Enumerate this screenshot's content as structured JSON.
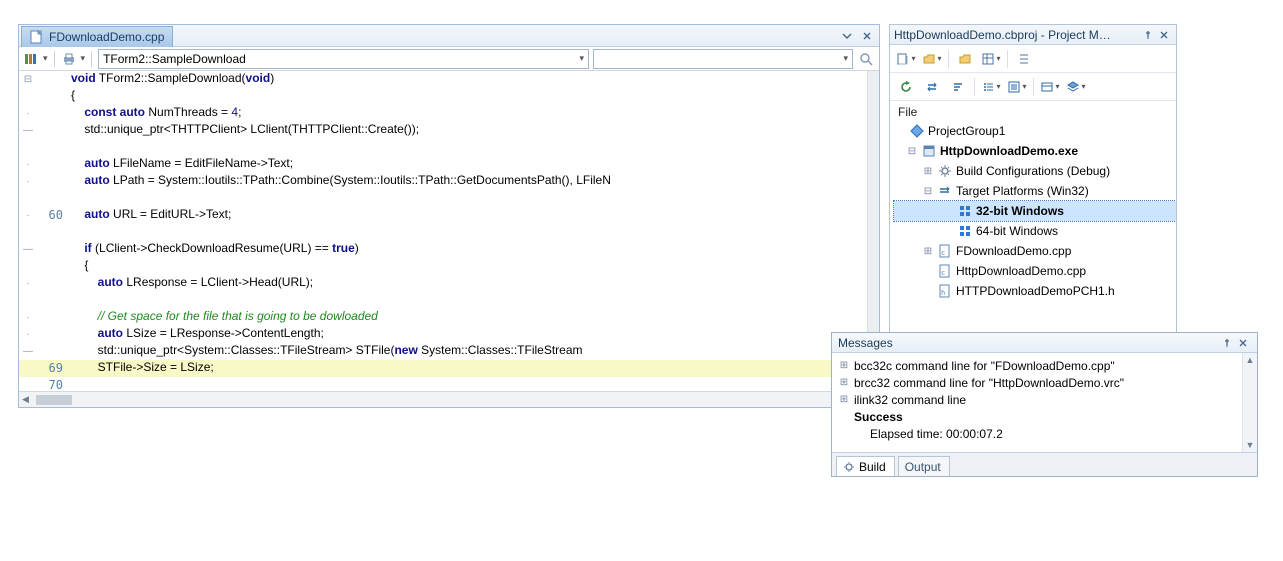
{
  "editor": {
    "tabLabel": "FDownloadDemo.cpp",
    "navSelection": "TForm2::SampleDownload",
    "lines": [
      {
        "fold": "⊟",
        "num": "",
        "html": "<span class='kw'>void</span> TForm2::SampleDownload(<span class='kw'>void</span>)"
      },
      {
        "fold": "",
        "num": "",
        "html": "{"
      },
      {
        "fold": "·",
        "num": "",
        "html": "    <span class='kw'>const auto</span> NumThreads = <span class='num'>4</span>;"
      },
      {
        "fold": "—",
        "num": "",
        "html": "    std::unique_ptr&lt;THTTPClient&gt; LClient(THTTPClient::Create());"
      },
      {
        "fold": "",
        "num": "",
        "html": ""
      },
      {
        "fold": "·",
        "num": "",
        "html": "    <span class='kw'>auto</span> LFileName = EditFileName-&gt;Text;"
      },
      {
        "fold": "·",
        "num": "",
        "html": "    <span class='kw'>auto</span> LPath = System::Ioutils::TPath::Combine(System::Ioutils::TPath::GetDocumentsPath(), LFileN"
      },
      {
        "fold": "",
        "num": "",
        "html": ""
      },
      {
        "fold": "·",
        "num": "60",
        "html": "    <span class='kw'>auto</span> URL = EditURL-&gt;Text;"
      },
      {
        "fold": "",
        "num": "",
        "html": ""
      },
      {
        "fold": "—",
        "num": "",
        "html": "    <span class='kw'>if</span> (LClient-&gt;CheckDownloadResume(URL) == <span class='kw'>true</span>)"
      },
      {
        "fold": "",
        "num": "",
        "html": "    {"
      },
      {
        "fold": "·",
        "num": "",
        "html": "        <span class='kw'>auto</span> LResponse = LClient-&gt;Head(URL);"
      },
      {
        "fold": "",
        "num": "",
        "html": ""
      },
      {
        "fold": "·",
        "num": "",
        "html": "        <span class='cmt'>// Get space for the file that is going to be dowloaded</span>"
      },
      {
        "fold": "·",
        "num": "",
        "html": "        <span class='kw'>auto</span> LSize = LResponse-&gt;ContentLength;"
      },
      {
        "fold": "—",
        "num": "",
        "html": "        std::unique_ptr&lt;System::Classes::TFileStream&gt; STFile(<span class='kw'>new</span> System::Classes::TFileStream"
      },
      {
        "fold": "",
        "num": "69",
        "html": "        STFile-&gt;Size = LSize;",
        "hl": true
      },
      {
        "fold": "",
        "num": "70",
        "html": ""
      }
    ]
  },
  "project": {
    "title": "HttpDownloadDemo.cbproj - Project M…",
    "fileLabel": "File",
    "tree": [
      {
        "ind": 0,
        "exp": "",
        "icon": "diamond",
        "label": "ProjectGroup1"
      },
      {
        "ind": 1,
        "exp": "⊟",
        "icon": "exe",
        "label": "HttpDownloadDemo.exe",
        "bold": true
      },
      {
        "ind": 2,
        "exp": "⊞",
        "icon": "gear",
        "label": "Build Configurations (Debug)"
      },
      {
        "ind": 2,
        "exp": "⊟",
        "icon": "target",
        "label": "Target Platforms (Win32)"
      },
      {
        "ind": 3,
        "exp": "",
        "icon": "win",
        "label": "32-bit Windows",
        "bold": true,
        "sel": true
      },
      {
        "ind": 3,
        "exp": "",
        "icon": "win",
        "label": "64-bit Windows"
      },
      {
        "ind": 2,
        "exp": "⊞",
        "icon": "cpp",
        "label": "FDownloadDemo.cpp"
      },
      {
        "ind": 2,
        "exp": "",
        "icon": "cpp",
        "label": "HttpDownloadDemo.cpp"
      },
      {
        "ind": 2,
        "exp": "",
        "icon": "h",
        "label": "HTTPDownloadDemoPCH1.h"
      }
    ]
  },
  "messages": {
    "title": "Messages",
    "rows": [
      {
        "exp": "⊞",
        "text": "bcc32c command line for \"FDownloadDemo.cpp\""
      },
      {
        "exp": "⊞",
        "text": "brcc32 command line for \"HttpDownloadDemo.vrc\""
      },
      {
        "exp": "⊞",
        "text": "ilink32 command line"
      },
      {
        "exp": "",
        "text": "Success",
        "bold": true
      },
      {
        "exp": "",
        "text": "Elapsed time: 00:00:07.2",
        "ind": true
      }
    ],
    "tabs": [
      {
        "label": "Build",
        "active": true,
        "icon": true
      },
      {
        "label": "Output",
        "active": false
      }
    ]
  }
}
